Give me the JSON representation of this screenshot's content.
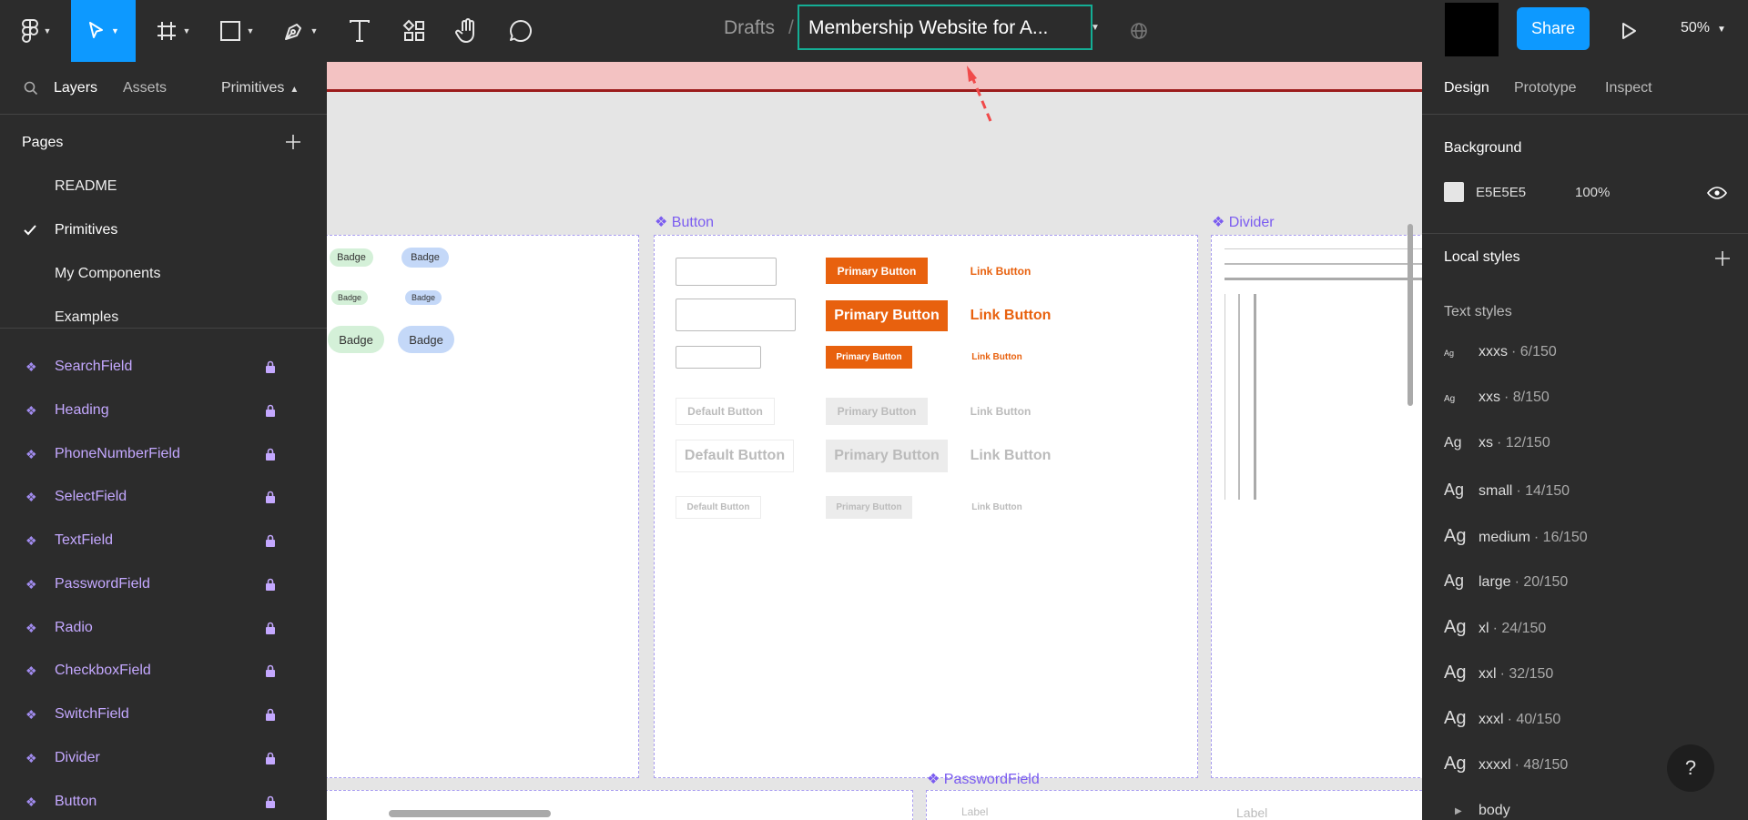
{
  "toolbar": {
    "drafts": "Drafts",
    "slash": "/",
    "file_name": "Membership Website for A...",
    "share": "Share",
    "zoom": "50%"
  },
  "left_panel": {
    "tabs": {
      "layers": "Layers",
      "assets": "Assets",
      "page": "Primitives"
    },
    "pages_heading": "Pages",
    "pages": [
      "README",
      "Primitives",
      "My Components",
      "Examples"
    ],
    "layers": [
      "SearchField",
      "Heading",
      "PhoneNumberField",
      "SelectField",
      "TextField",
      "PasswordField",
      "Radio",
      "CheckboxField",
      "SwitchField",
      "Divider",
      "Button"
    ]
  },
  "right_panel": {
    "tabs": {
      "design": "Design",
      "prototype": "Prototype",
      "inspect": "Inspect"
    },
    "background_heading": "Background",
    "background_hex": "E5E5E5",
    "background_opacity": "100%",
    "local_styles": "Local styles",
    "text_styles": "Text styles",
    "styles": [
      {
        "ag": "Ag",
        "name": "xxxs",
        "meta": "· 6/150"
      },
      {
        "ag": "Ag",
        "name": "xxs",
        "meta": "· 8/150"
      },
      {
        "ag": "Ag",
        "name": "xs",
        "meta": "· 12/150"
      },
      {
        "ag": "Ag",
        "name": "small",
        "meta": "· 14/150"
      },
      {
        "ag": "Ag",
        "name": "medium",
        "meta": "· 16/150"
      },
      {
        "ag": "Ag",
        "name": "large",
        "meta": "· 20/150"
      },
      {
        "ag": "Ag",
        "name": "xl",
        "meta": "· 24/150"
      },
      {
        "ag": "Ag",
        "name": "xxl",
        "meta": "· 32/150"
      },
      {
        "ag": "Ag",
        "name": "xxxl",
        "meta": "· 40/150"
      },
      {
        "ag": "Ag",
        "name": "xxxxl",
        "meta": "· 48/150"
      }
    ],
    "body_group": "body",
    "help": "?"
  },
  "canvas": {
    "frame_labels": {
      "button": "Button",
      "divider": "Divider",
      "password": "PasswordField"
    },
    "badge": "Badge",
    "primary": "Primary Button",
    "link": "Link Button",
    "default": "Default Button",
    "label": "Label"
  },
  "colors": {
    "accent": "#0d99ff",
    "selection": "#14ae95",
    "orange": "#e8610e",
    "component": "#c4a8ff"
  },
  "icons": [
    "figma-menu-icon",
    "move-tool-icon",
    "frame-tool-icon",
    "shape-tool-icon",
    "pen-tool-icon",
    "text-tool-icon",
    "resources-icon",
    "hand-tool-icon",
    "comment-icon",
    "globe-icon",
    "play-icon",
    "search-icon",
    "plus-icon",
    "check-icon",
    "component-icon",
    "lock-icon",
    "eye-icon",
    "help-icon"
  ]
}
